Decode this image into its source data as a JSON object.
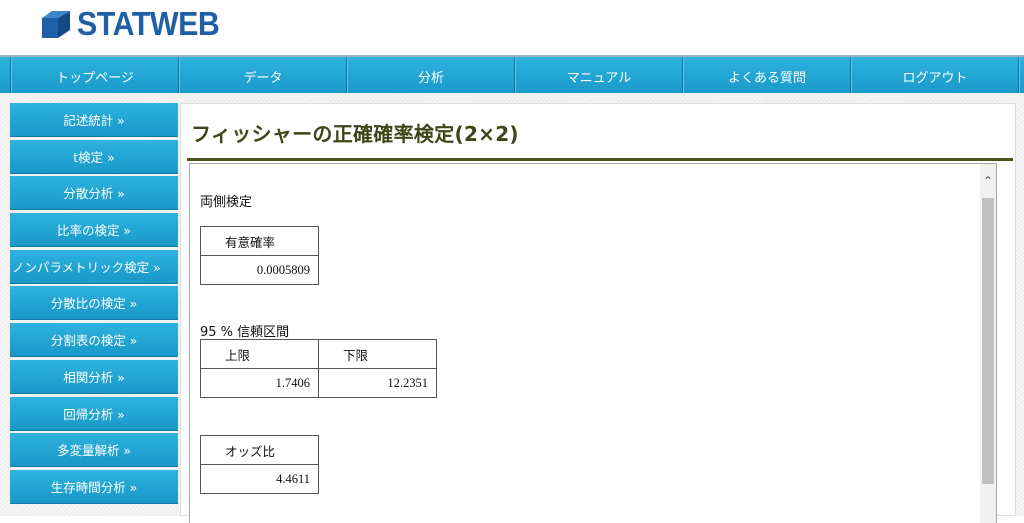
{
  "logo": {
    "text": "STATWEB"
  },
  "nav": {
    "items": [
      "トップページ",
      "データ",
      "分析",
      "マニュアル",
      "よくある質問",
      "ログアウト"
    ]
  },
  "sidebar": {
    "items": [
      "記述統計 »",
      "t検定 »",
      "分散分析 »",
      "比率の検定 »",
      "ノンパラメトリック検定 »",
      "分散比の検定 »",
      "分割表の検定 »",
      "相関分析 »",
      "回帰分析 »",
      "多変量解析 »",
      "生存時間分析 »"
    ]
  },
  "main": {
    "title": "フィッシャーの正確確率検定(2×2)",
    "test_type": "両側検定",
    "p_table": {
      "header": "有意確率",
      "value": "0.0005809"
    },
    "ci_label": "95 % 信頼区間",
    "ci_table": {
      "headers": [
        "上限",
        "下限"
      ],
      "values": [
        "1.7406",
        "12.2351"
      ]
    },
    "or_table": {
      "header": "オッズ比",
      "value": "4.4611"
    }
  },
  "colors": {
    "nav": "#1ea3d1",
    "title": "#3c4616",
    "logo": "#1f5fa6"
  },
  "icons": {
    "logo_icon": "cube-icon",
    "scroll_up": "chevron-up-icon"
  }
}
